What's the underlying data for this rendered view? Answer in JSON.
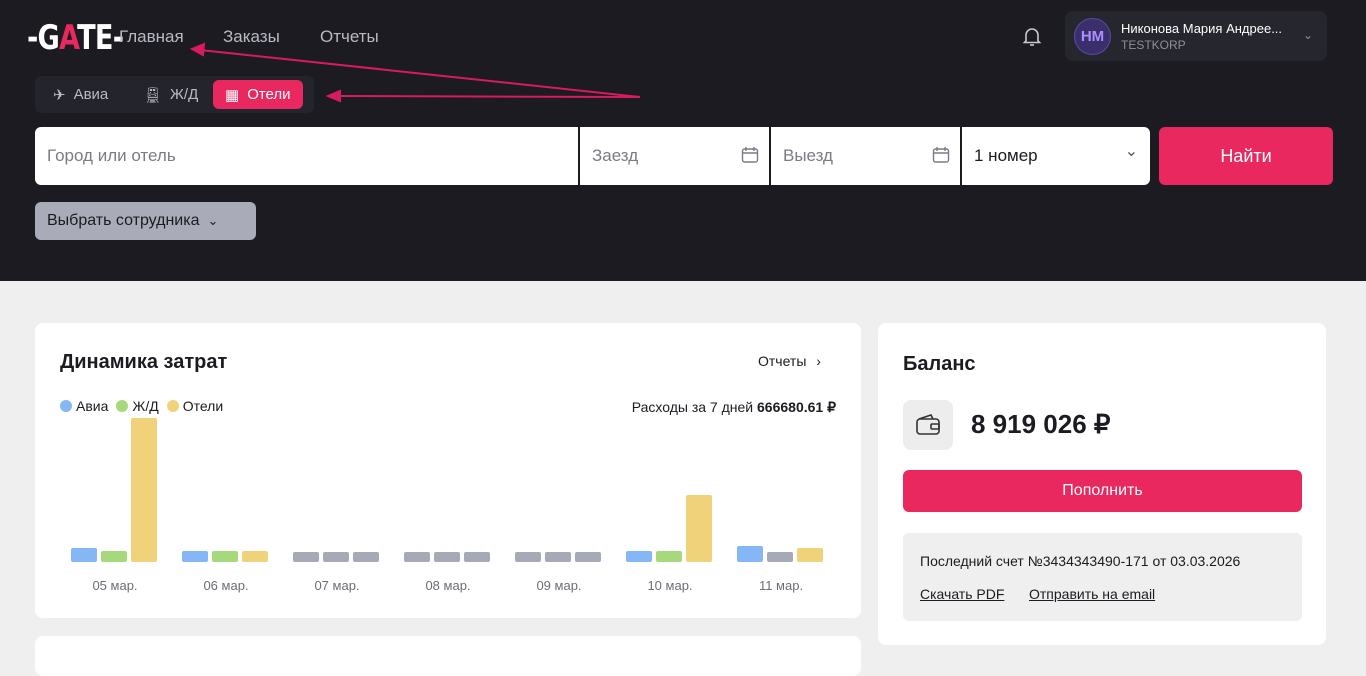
{
  "header": {
    "logo": "GATE",
    "nav": [
      "Главная",
      "Заказы",
      "Отчеты"
    ],
    "user": {
      "initials": "НМ",
      "name": "Никонова Мария Андрее...",
      "org": "TESTKORP"
    }
  },
  "tabs": [
    {
      "label": "Авиа",
      "icon": "plane-icon"
    },
    {
      "label": "Ж/Д",
      "icon": "train-icon"
    },
    {
      "label": "Отели",
      "icon": "hotel-icon",
      "active": true
    }
  ],
  "search": {
    "city_placeholder": "Город или отель",
    "checkin_placeholder": "Заезд",
    "checkout_placeholder": "Выезд",
    "rooms": "1 номер",
    "find": "Найти",
    "employee": "Выбрать сотрудника"
  },
  "dynamics": {
    "title": "Динамика затрат",
    "reports_link": "Отчеты",
    "spend_label": "Расходы за 7 дней",
    "spend_value": "666680.61 ₽"
  },
  "chart_data": {
    "type": "bar",
    "categories": [
      "05 мар.",
      "06 мар.",
      "07 мар.",
      "08 мар.",
      "09 мар.",
      "10 мар.",
      "11 мар."
    ],
    "series": [
      {
        "name": "Авиа",
        "color": "#85b6f5",
        "values": [
          12000,
          3000,
          0,
          0,
          0,
          3000,
          20000
        ]
      },
      {
        "name": "Ж/Д",
        "color": "#a6d87c",
        "values": [
          3000,
          3000,
          0,
          0,
          0,
          3000,
          0
        ]
      },
      {
        "name": "Отели",
        "color": "#f0d27a",
        "values": [
          420000,
          3000,
          0,
          0,
          0,
          180000,
          12000
        ]
      }
    ],
    "empty_color": "#a6aab6"
  },
  "balance": {
    "title": "Баланс",
    "amount": "8 919 026 ₽",
    "topup": "Пополнить",
    "last_invoice": "Последний счет №3434343490-171 от 03.03.2026",
    "download": "Скачать PDF",
    "email": "Отправить на email"
  }
}
